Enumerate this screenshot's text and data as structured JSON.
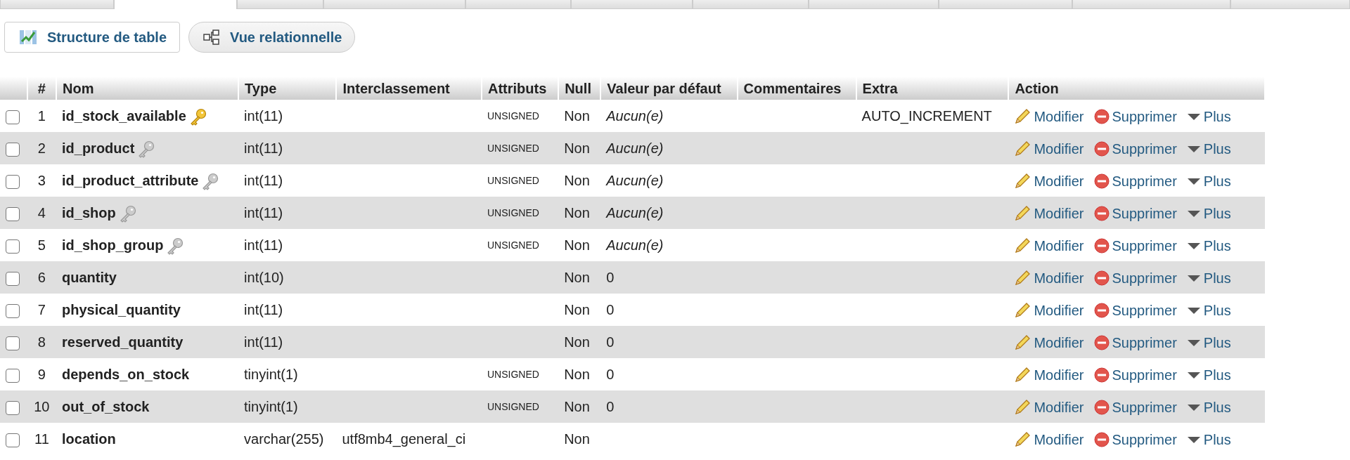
{
  "tabs": [
    {
      "selected": false
    },
    {
      "selected": true
    },
    {
      "selected": false
    },
    {
      "selected": false
    },
    {
      "selected": false
    },
    {
      "selected": false
    },
    {
      "selected": false
    },
    {
      "selected": false
    },
    {
      "selected": false
    },
    {
      "selected": false
    },
    {
      "selected": false
    }
  ],
  "subtabs": [
    {
      "label": "Structure de table",
      "selected": true,
      "kind": "structure"
    },
    {
      "label": "Vue relationnelle",
      "selected": false,
      "kind": "relation"
    }
  ],
  "table": {
    "columns": [
      "#",
      "Nom",
      "Type",
      "Interclassement",
      "Attributs",
      "Null",
      "Valeur par défaut",
      "Commentaires",
      "Extra",
      "Action"
    ],
    "rows": [
      {
        "checked": false,
        "num": "1",
        "name": "id_stock_available",
        "kind": "primary",
        "type": "int(11)",
        "attributes": "UNSIGNED",
        "null": "Non",
        "default": "Aucun(e)",
        "default_unset": true,
        "extra": "AUTO_INCREMENT",
        "actions": [
          "Modifier",
          "Supprimer",
          "Plus"
        ]
      },
      {
        "checked": false,
        "num": "2",
        "name": "id_product",
        "kind": "index",
        "type": "int(11)",
        "attributes": "UNSIGNED",
        "null": "Non",
        "default": "Aucun(e)",
        "default_unset": true,
        "actions": [
          "Modifier",
          "Supprimer",
          "Plus"
        ]
      },
      {
        "checked": false,
        "num": "3",
        "name": "id_product_attribute",
        "kind": "index",
        "type": "int(11)",
        "attributes": "UNSIGNED",
        "null": "Non",
        "default": "Aucun(e)",
        "default_unset": true,
        "actions": [
          "Modifier",
          "Supprimer",
          "Plus"
        ]
      },
      {
        "checked": false,
        "num": "4",
        "name": "id_shop",
        "kind": "index",
        "type": "int(11)",
        "attributes": "UNSIGNED",
        "null": "Non",
        "default": "Aucun(e)",
        "default_unset": true,
        "actions": [
          "Modifier",
          "Supprimer",
          "Plus"
        ]
      },
      {
        "checked": false,
        "num": "5",
        "name": "id_shop_group",
        "kind": "index",
        "type": "int(11)",
        "attributes": "UNSIGNED",
        "null": "Non",
        "default": "Aucun(e)",
        "default_unset": true,
        "actions": [
          "Modifier",
          "Supprimer",
          "Plus"
        ]
      },
      {
        "checked": false,
        "num": "6",
        "name": "quantity",
        "kind": "plain",
        "type": "int(10)",
        "null": "Non",
        "default": "0",
        "default_unset": false,
        "actions": [
          "Modifier",
          "Supprimer",
          "Plus"
        ]
      },
      {
        "checked": false,
        "num": "7",
        "name": "physical_quantity",
        "kind": "plain",
        "type": "int(11)",
        "null": "Non",
        "default": "0",
        "default_unset": false,
        "actions": [
          "Modifier",
          "Supprimer",
          "Plus"
        ]
      },
      {
        "checked": false,
        "num": "8",
        "name": "reserved_quantity",
        "kind": "plain",
        "type": "int(11)",
        "null": "Non",
        "default": "0",
        "default_unset": false,
        "actions": [
          "Modifier",
          "Supprimer",
          "Plus"
        ]
      },
      {
        "checked": false,
        "num": "9",
        "name": "depends_on_stock",
        "kind": "plain",
        "type": "tinyint(1)",
        "attributes": "UNSIGNED",
        "null": "Non",
        "default": "0",
        "default_unset": false,
        "actions": [
          "Modifier",
          "Supprimer",
          "Plus"
        ]
      },
      {
        "checked": false,
        "num": "10",
        "name": "out_of_stock",
        "kind": "plain",
        "type": "tinyint(1)",
        "attributes": "UNSIGNED",
        "null": "Non",
        "default": "0",
        "default_unset": false,
        "actions": [
          "Modifier",
          "Supprimer",
          "Plus"
        ]
      },
      {
        "checked": false,
        "num": "11",
        "name": "location",
        "kind": "plain",
        "type": "varchar(255)",
        "collation": "utf8mb4_general_ci",
        "null": "Non",
        "actions": [
          "Modifier",
          "Supprimer",
          "Plus"
        ]
      }
    ]
  }
}
